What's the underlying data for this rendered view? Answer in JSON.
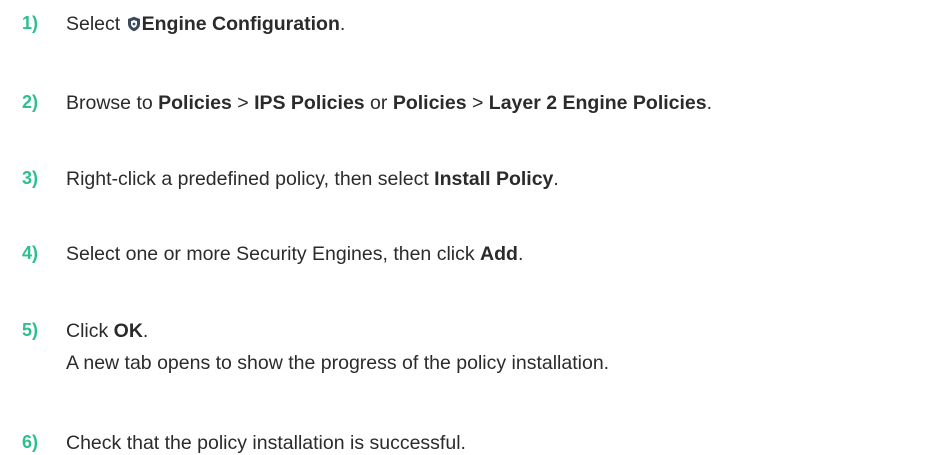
{
  "colors": {
    "step_number": "#2fbf8f",
    "text": "#2b2b2b"
  },
  "steps": [
    {
      "num": "1)",
      "t1": "Select ",
      "icon": "shield-icon",
      "b1": "Engine Configuration",
      "t2": "."
    },
    {
      "num": "2)",
      "t1": "Browse to ",
      "b1": "Policies",
      "t2": " > ",
      "b2": "IPS Policies",
      "t3": " or ",
      "b3": "Policies",
      "t4": " > ",
      "b4": "Layer 2 Engine Policies",
      "t5": "."
    },
    {
      "num": "3)",
      "t1": "Right-click a predefined policy, then select ",
      "b1": "Install Policy",
      "t2": "."
    },
    {
      "num": "4)",
      "t1": "Select one or more Security Engines, then click ",
      "b1": "Add",
      "t2": "."
    },
    {
      "num": "5)",
      "t1": "Click ",
      "b1": "OK",
      "t2": ".",
      "sub": "A new tab opens to show the progress of the policy installation."
    },
    {
      "num": "6)",
      "t1": "Check that the policy installation is successful."
    }
  ]
}
